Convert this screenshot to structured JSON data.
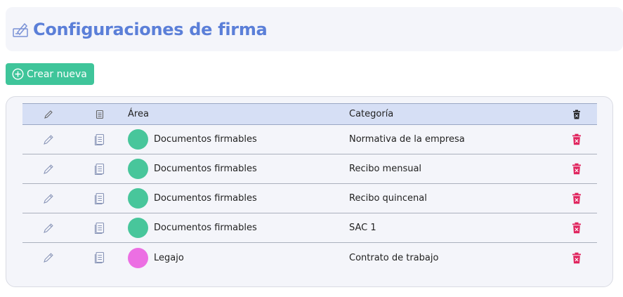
{
  "header": {
    "title": "Configuraciones de firma",
    "icon": "signature-icon"
  },
  "create_button": {
    "label": "Crear nueva",
    "icon": "plus-circle-icon"
  },
  "table": {
    "columns": {
      "edit": "pencil-icon",
      "doc": "document-icon",
      "area": "Área",
      "category": "Categoría",
      "delete": "trash-icon"
    },
    "rows": [
      {
        "area": "Documentos firmables",
        "area_color": "#48c69b",
        "category": "Normativa de la empresa"
      },
      {
        "area": "Documentos firmables",
        "area_color": "#48c69b",
        "category": "Recibo mensual"
      },
      {
        "area": "Documentos firmables",
        "area_color": "#48c69b",
        "category": "Recibo quincenal"
      },
      {
        "area": "Documentos firmables",
        "area_color": "#48c69b",
        "category": "SAC 1"
      },
      {
        "area": "Legajo",
        "area_color": "#ec6fe3",
        "category": "Contrato de trabajo"
      }
    ]
  },
  "colors": {
    "accent": "#5b7fd8",
    "create": "#3fc59a",
    "delete": "#e0245e"
  }
}
